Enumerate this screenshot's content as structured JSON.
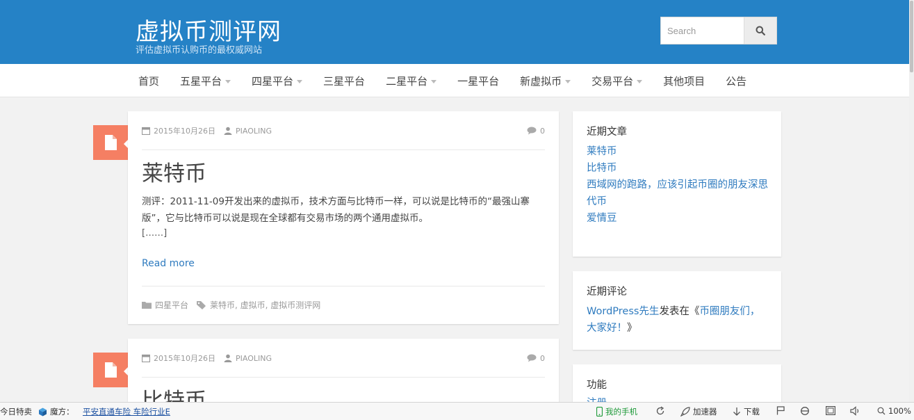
{
  "site": {
    "title": "虚拟币测评网",
    "description": "评估虚拟币认购币的最权威网站"
  },
  "search": {
    "placeholder": "Search"
  },
  "nav": {
    "items": [
      {
        "label": "首页"
      },
      {
        "label": "五星平台"
      },
      {
        "label": "四星平台"
      },
      {
        "label": "三星平台"
      },
      {
        "label": "二星平台"
      },
      {
        "label": "一星平台"
      },
      {
        "label": "新虚拟币"
      },
      {
        "label": "交易平台"
      },
      {
        "label": "其他项目"
      },
      {
        "label": "公告"
      }
    ]
  },
  "posts": [
    {
      "date": "2015年10月26日",
      "author": "PIAOLING",
      "comments": "0",
      "title": "莱特币",
      "excerpt": "测评：2011-11-09开发出来的虚拟币，技术方面与比特币一样，可以说是比特币的“最强山寨版”，它与比特币可以说是现在全球都有交易市场的两个通用虚拟币。",
      "ellipsis": "[……]",
      "read_more": "Read more",
      "category": "四星平台",
      "tags": "莱特币, 虚拟币, 虚拟币测评网"
    },
    {
      "date": "2015年10月26日",
      "author": "PIAOLING",
      "comments": "0",
      "title": "比特币"
    }
  ],
  "sidebar": {
    "recent_posts": {
      "title": "近期文章",
      "items": [
        {
          "label": "莱特币"
        },
        {
          "label": "比特币"
        },
        {
          "label": "西域网的跑路，应该引起币圈的朋友深思"
        },
        {
          "label": "代币"
        },
        {
          "label": "爱情豆"
        }
      ]
    },
    "recent_comments": {
      "title": "近期评论",
      "author": "WordPress先生",
      "on_text": "发表在《",
      "post": "币圈朋友们，大家好！",
      "close": "》"
    },
    "meta": {
      "title": "功能",
      "first_item": "注册"
    }
  },
  "statusbar": {
    "news": "今日特卖",
    "cube_label": "魔方：",
    "ad_link": "平安直通车险 车险行业E",
    "phone": "我的手机",
    "accelerator": "加速器",
    "download": "下载",
    "zoom": "100%"
  },
  "colors": {
    "header": "#2582c6",
    "link": "#2f7bbf",
    "post_icon": "#f57f63"
  }
}
